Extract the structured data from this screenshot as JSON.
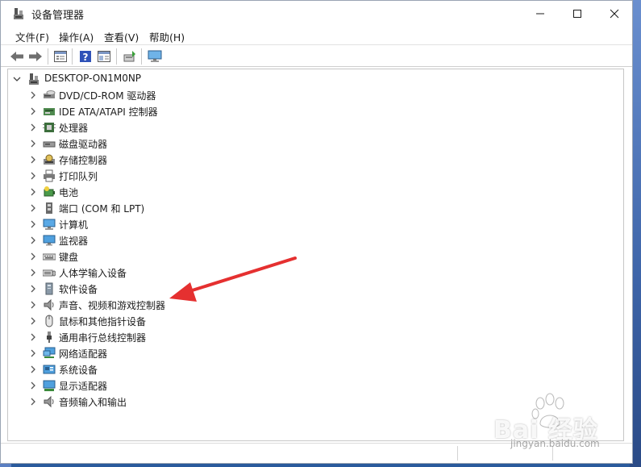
{
  "window": {
    "title": "设备管理器"
  },
  "menu": [
    "文件(F)",
    "操作(A)",
    "查看(V)",
    "帮助(H)"
  ],
  "toolbar": [
    "back-icon",
    "forward-icon",
    "properties-icon",
    "help-icon",
    "view-icon",
    "scan-icon",
    "monitor-icon"
  ],
  "tree": {
    "root": "DESKTOP-ON1M0NP",
    "items": [
      {
        "label": "DVD/CD-ROM 驱动器",
        "icon": "dvd-drive-icon"
      },
      {
        "label": "IDE ATA/ATAPI 控制器",
        "icon": "ide-controller-icon"
      },
      {
        "label": "处理器",
        "icon": "processor-icon"
      },
      {
        "label": "磁盘驱动器",
        "icon": "disk-drive-icon"
      },
      {
        "label": "存储控制器",
        "icon": "storage-controller-icon"
      },
      {
        "label": "打印队列",
        "icon": "printer-icon"
      },
      {
        "label": "电池",
        "icon": "battery-icon"
      },
      {
        "label": "端口 (COM 和 LPT)",
        "icon": "port-icon"
      },
      {
        "label": "计算机",
        "icon": "computer-icon"
      },
      {
        "label": "监视器",
        "icon": "monitor-icon"
      },
      {
        "label": "键盘",
        "icon": "keyboard-icon"
      },
      {
        "label": "人体学输入设备",
        "icon": "hid-icon"
      },
      {
        "label": "软件设备",
        "icon": "software-device-icon"
      },
      {
        "label": "声音、视频和游戏控制器",
        "icon": "speaker-icon"
      },
      {
        "label": "鼠标和其他指针设备",
        "icon": "mouse-icon"
      },
      {
        "label": "通用串行总线控制器",
        "icon": "usb-icon"
      },
      {
        "label": "网络适配器",
        "icon": "network-adapter-icon"
      },
      {
        "label": "系统设备",
        "icon": "system-device-icon"
      },
      {
        "label": "显示适配器",
        "icon": "display-adapter-icon"
      },
      {
        "label": "音频输入和输出",
        "icon": "audio-io-icon"
      }
    ]
  },
  "watermark": {
    "brand": "Bai 经验",
    "url": "jingyan.baidu.com"
  },
  "colors": {
    "arrow": "#e53030",
    "accent": "#0067c0"
  }
}
